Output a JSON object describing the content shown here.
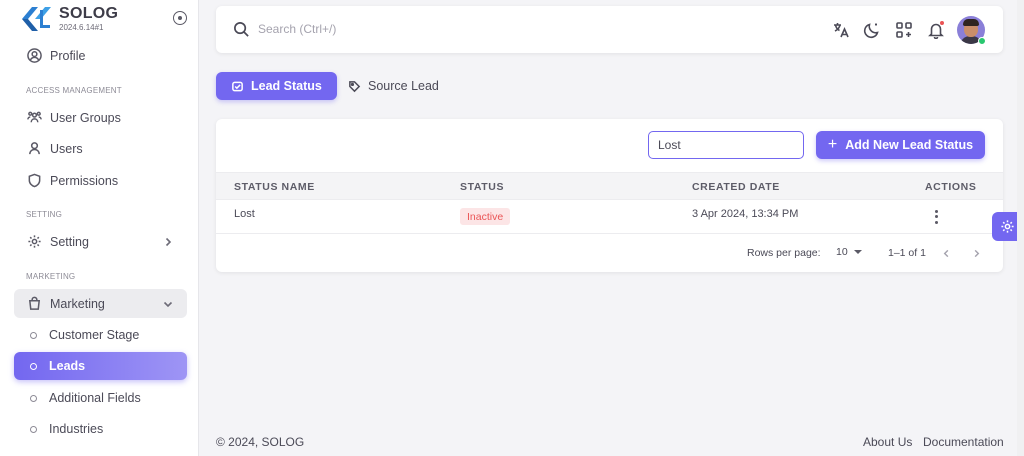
{
  "brand": {
    "name": "SOLOG",
    "version": "2024.6.14#1"
  },
  "sidebar": {
    "profile": "Profile",
    "section_access": "ACCESS MANAGEMENT",
    "access_items": [
      {
        "label": "User Groups",
        "icon": "users-group-icon"
      },
      {
        "label": "Users",
        "icon": "user-icon"
      },
      {
        "label": "Permissions",
        "icon": "shield-icon"
      }
    ],
    "section_setting": "SETTING",
    "setting": "Setting",
    "section_marketing": "MARKETING",
    "marketing": "Marketing",
    "marketing_items": [
      "Customer Stage",
      "Leads",
      "Additional Fields",
      "Industries"
    ],
    "active_item": "Leads"
  },
  "topbar": {
    "search_placeholder": "Search (Ctrl+/)"
  },
  "tabs": [
    {
      "label": "Lead Status",
      "active": true
    },
    {
      "label": "Source Lead",
      "active": false
    }
  ],
  "toolbar": {
    "filter_value": "Lost",
    "add_label": "Add New Lead Status"
  },
  "table": {
    "headers": [
      "STATUS NAME",
      "STATUS",
      "CREATED DATE",
      "ACTIONS"
    ],
    "rows": [
      {
        "name": "Lost",
        "status": "Inactive",
        "created": "3 Apr 2024, 13:34 PM"
      }
    ]
  },
  "pagination": {
    "rows_per_page_label": "Rows per page:",
    "rows_per_page": "10",
    "range": "1–1 of 1"
  },
  "footer": {
    "copyright": "© 2024, SOLOG",
    "links": [
      "About Us",
      "Documentation"
    ]
  },
  "colors": {
    "primary": "#7367f0",
    "danger": "#ea5455",
    "danger_bg": "#fce5e6",
    "online": "#28c76f"
  }
}
